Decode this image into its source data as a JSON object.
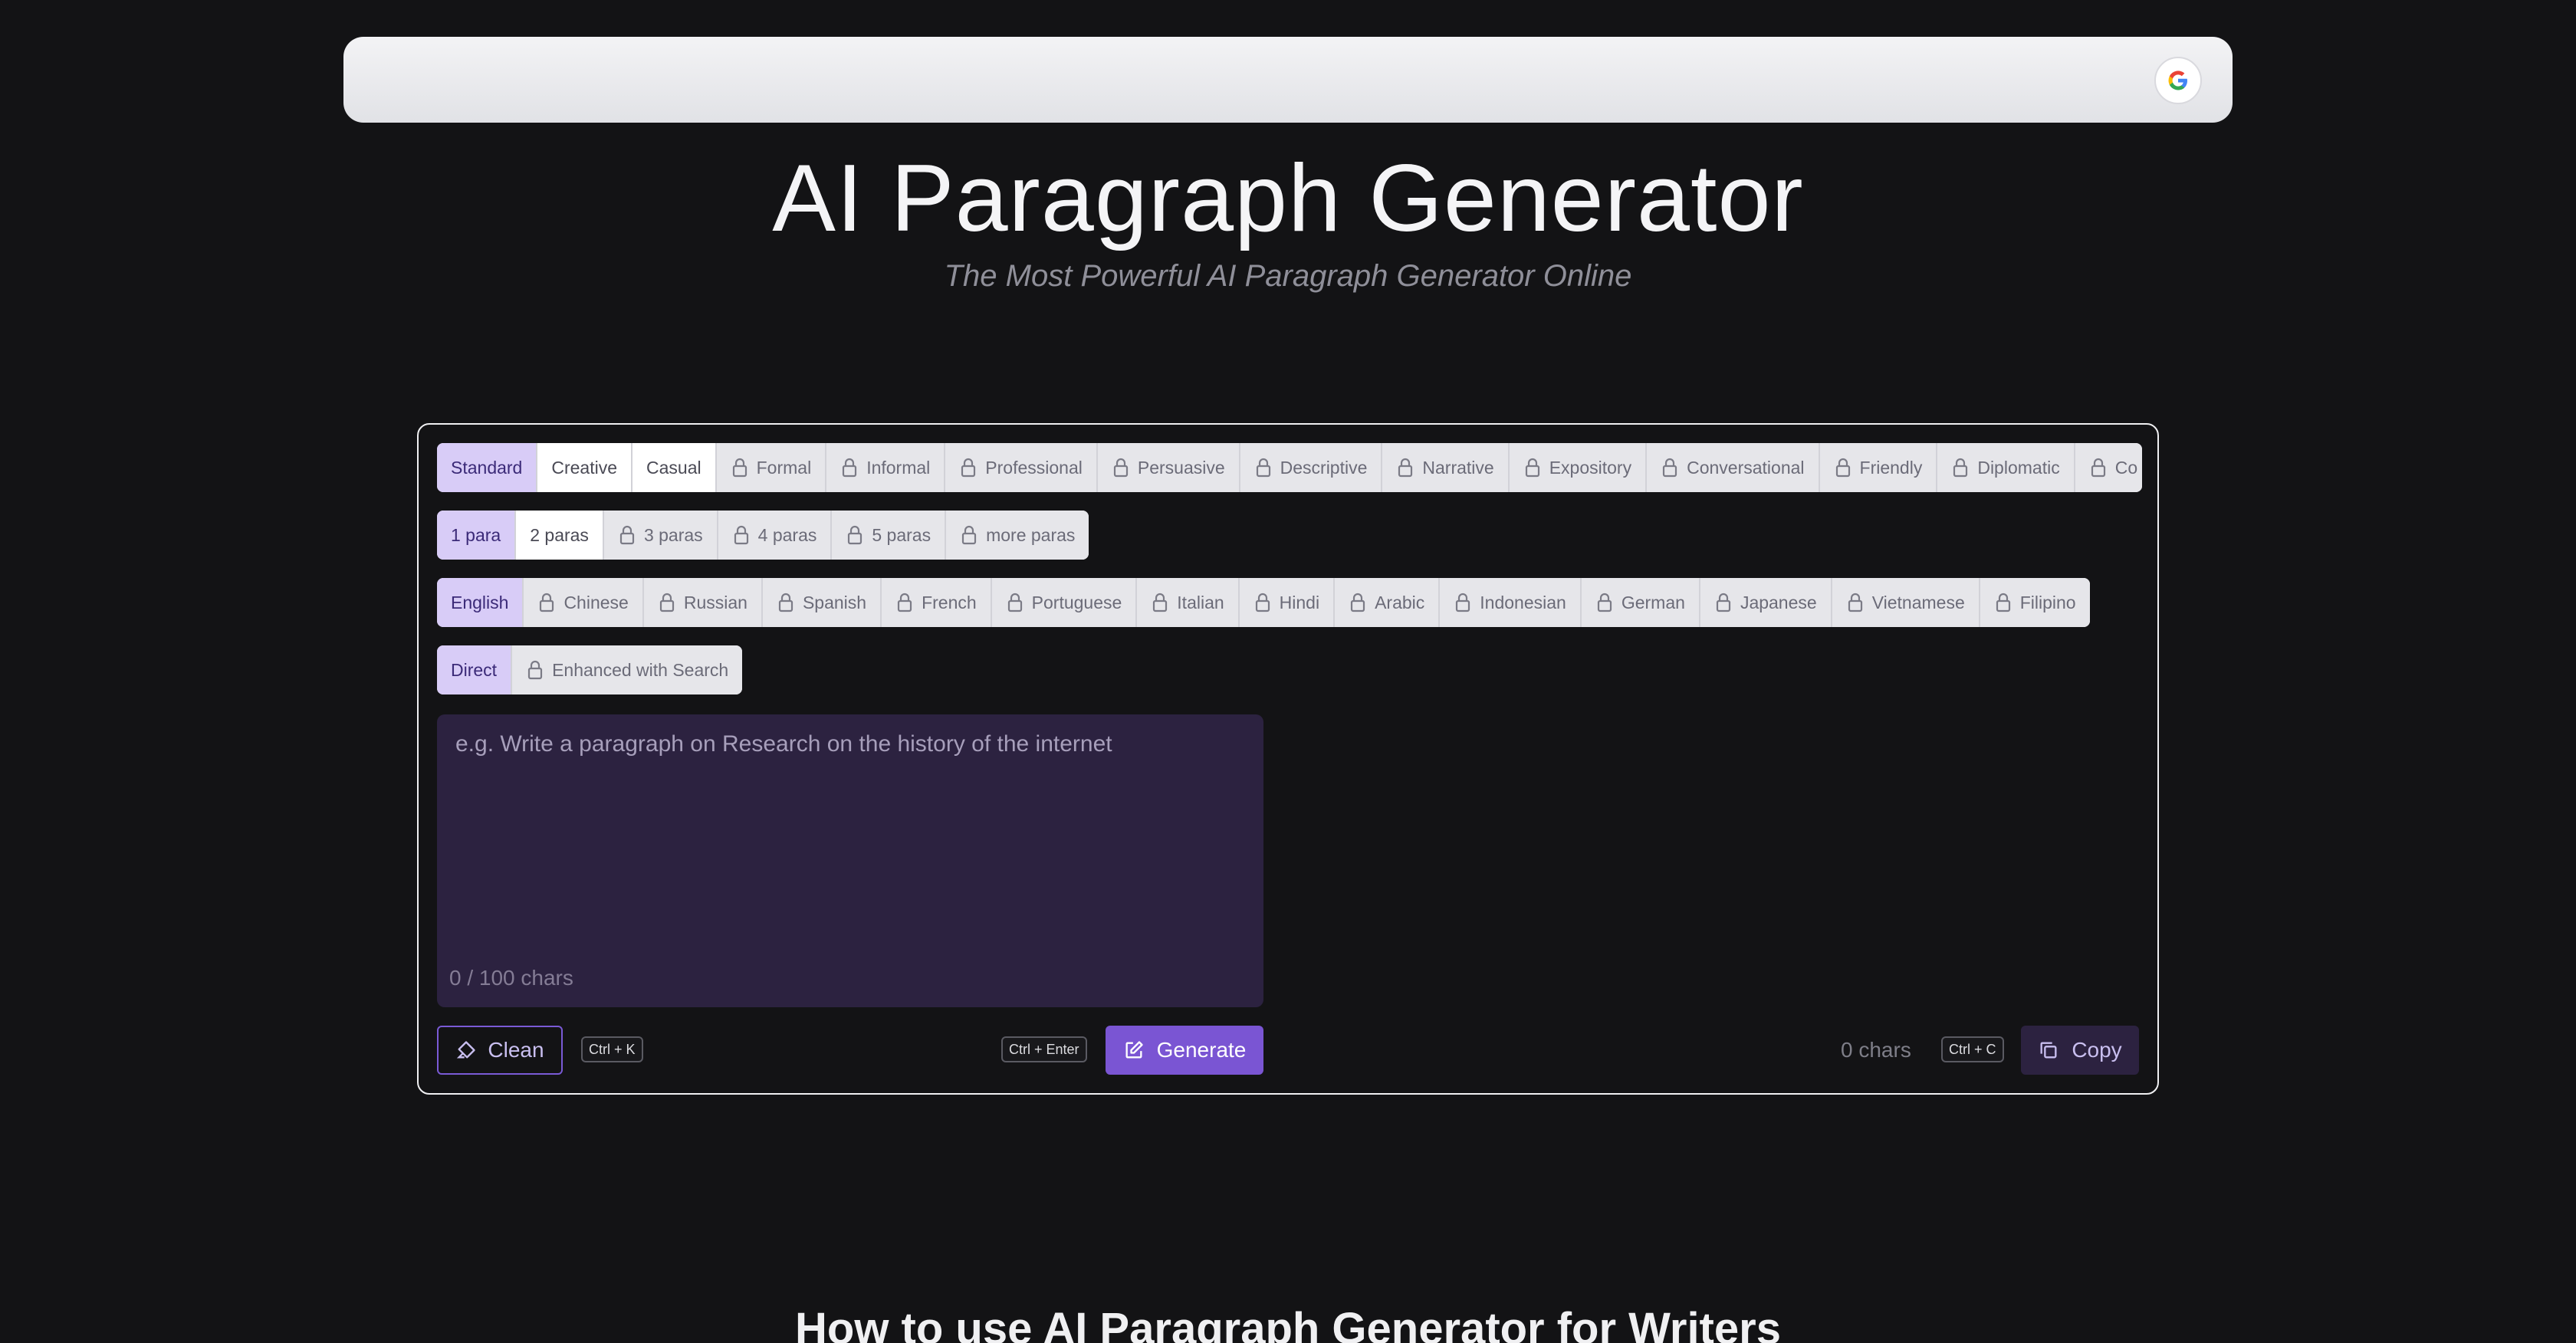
{
  "app": {
    "title": "AI Paragraph Generator",
    "subtitle": "The Most Powerful AI Paragraph Generator Online",
    "google_icon": "google-g-icon"
  },
  "tones": {
    "selected": "Standard",
    "items": [
      {
        "label": "Standard",
        "state": "selected",
        "locked": false
      },
      {
        "label": "Creative",
        "state": "available",
        "locked": false
      },
      {
        "label": "Casual",
        "state": "available",
        "locked": false
      },
      {
        "label": "Formal",
        "state": "locked",
        "locked": true
      },
      {
        "label": "Informal",
        "state": "locked",
        "locked": true
      },
      {
        "label": "Professional",
        "state": "locked",
        "locked": true
      },
      {
        "label": "Persuasive",
        "state": "locked",
        "locked": true
      },
      {
        "label": "Descriptive",
        "state": "locked",
        "locked": true
      },
      {
        "label": "Narrative",
        "state": "locked",
        "locked": true
      },
      {
        "label": "Expository",
        "state": "locked",
        "locked": true
      },
      {
        "label": "Conversational",
        "state": "locked",
        "locked": true
      },
      {
        "label": "Friendly",
        "state": "locked",
        "locked": true
      },
      {
        "label": "Diplomatic",
        "state": "locked",
        "locked": true
      },
      {
        "label": "Co",
        "state": "locked",
        "locked": true
      }
    ]
  },
  "lengths": {
    "selected": "1 para",
    "items": [
      {
        "label": "1 para",
        "state": "selected",
        "locked": false
      },
      {
        "label": "2 paras",
        "state": "available",
        "locked": false
      },
      {
        "label": "3 paras",
        "state": "locked",
        "locked": true
      },
      {
        "label": "4 paras",
        "state": "locked",
        "locked": true
      },
      {
        "label": "5 paras",
        "state": "locked",
        "locked": true
      },
      {
        "label": "more paras",
        "state": "locked",
        "locked": true
      }
    ]
  },
  "languages": {
    "selected": "English",
    "items": [
      {
        "label": "English",
        "state": "selected",
        "locked": false
      },
      {
        "label": "Chinese",
        "state": "locked",
        "locked": true
      },
      {
        "label": "Russian",
        "state": "locked",
        "locked": true
      },
      {
        "label": "Spanish",
        "state": "locked",
        "locked": true
      },
      {
        "label": "French",
        "state": "locked",
        "locked": true
      },
      {
        "label": "Portuguese",
        "state": "locked",
        "locked": true
      },
      {
        "label": "Italian",
        "state": "locked",
        "locked": true
      },
      {
        "label": "Hindi",
        "state": "locked",
        "locked": true
      },
      {
        "label": "Arabic",
        "state": "locked",
        "locked": true
      },
      {
        "label": "Indonesian",
        "state": "locked",
        "locked": true
      },
      {
        "label": "German",
        "state": "locked",
        "locked": true
      },
      {
        "label": "Japanese",
        "state": "locked",
        "locked": true
      },
      {
        "label": "Vietnamese",
        "state": "locked",
        "locked": true
      },
      {
        "label": "Filipino",
        "state": "locked",
        "locked": true
      }
    ]
  },
  "modes": {
    "selected": "Direct",
    "items": [
      {
        "label": "Direct",
        "state": "selected",
        "locked": false
      },
      {
        "label": "Enhanced with Search",
        "state": "locked",
        "locked": true
      }
    ]
  },
  "input": {
    "value": "",
    "placeholder": "e.g. Write a paragraph on Research on the history of the internet",
    "counter": "0 / 100 chars"
  },
  "actions": {
    "clean_label": "Clean",
    "clean_shortcut": "Ctrl + K",
    "generate_label": "Generate",
    "generate_shortcut": "Ctrl + Enter",
    "output_count": "0 chars",
    "copy_shortcut": "Ctrl + C",
    "copy_label": "Copy"
  },
  "section": {
    "heading": "How to use AI Paragraph Generator for Writers"
  },
  "colors": {
    "background": "#131315",
    "accent": "#7a55d3",
    "selected_chip": "#d8ccf7",
    "input_bg": "#2c2240"
  }
}
